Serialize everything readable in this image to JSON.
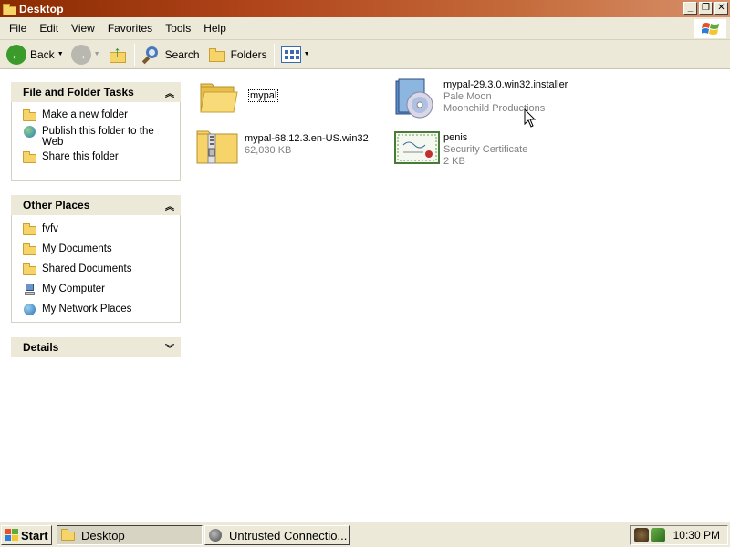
{
  "window": {
    "title": "Desktop",
    "buttons": {
      "minimize": "_",
      "maximize": "❐",
      "close": "✕"
    }
  },
  "menu": [
    "File",
    "Edit",
    "View",
    "Favorites",
    "Tools",
    "Help"
  ],
  "toolbar": {
    "back": "Back",
    "search": "Search",
    "folders": "Folders"
  },
  "left_panel": {
    "tasks": {
      "title": "File and Folder Tasks",
      "items": [
        "Make a new folder",
        "Publish this folder to the Web",
        "Share this folder"
      ]
    },
    "places": {
      "title": "Other Places",
      "items": [
        "fvfv",
        "My Documents",
        "Shared Documents",
        "My Computer",
        "My Network Places"
      ]
    },
    "details": {
      "title": "Details"
    }
  },
  "files": [
    {
      "name": "mypal",
      "type": "folder"
    },
    {
      "name": "mypal-29.3.0.win32.installer",
      "line2": "Pale Moon",
      "line3": "Moonchild Productions",
      "type": "installer"
    },
    {
      "name": "mypal-68.12.3.en-US.win32",
      "line2": "62,030 KB",
      "type": "zip"
    },
    {
      "name": "penis",
      "line2": "Security Certificate",
      "line3": "2 KB",
      "type": "certificate"
    }
  ],
  "taskbar": {
    "start": "Start",
    "tasks": [
      "Desktop",
      "Untrusted Connectio..."
    ],
    "clock": "10:30 PM"
  },
  "colors": {
    "titlebar": "#b0441b",
    "chrome": "#ece9d8",
    "folder": "#f6d46a"
  }
}
